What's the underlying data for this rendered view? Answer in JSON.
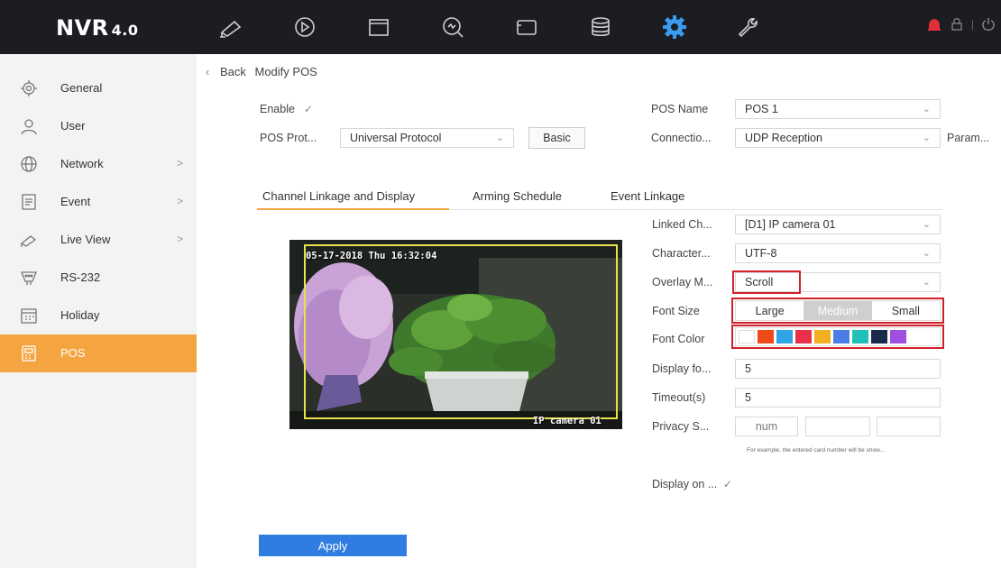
{
  "header": {
    "logo_main": "NVR",
    "logo_version": "4.0",
    "nav_icons": [
      "live-view-icon",
      "playback-icon",
      "file-icon",
      "smart-search-icon",
      "picture-icon",
      "storage-icon",
      "settings-icon",
      "maintenance-icon"
    ],
    "active_nav": "settings-icon",
    "accent": "#3b9bf0",
    "alarm_color": "#e0303a"
  },
  "sidebar": {
    "items": [
      {
        "label": "General",
        "icon": "gear-icon",
        "has_chevron": false
      },
      {
        "label": "User",
        "icon": "user-icon",
        "has_chevron": false
      },
      {
        "label": "Network",
        "icon": "globe-icon",
        "has_chevron": true
      },
      {
        "label": "Event",
        "icon": "event-icon",
        "has_chevron": true
      },
      {
        "label": "Live View",
        "icon": "camera-icon",
        "has_chevron": true
      },
      {
        "label": "RS-232",
        "icon": "rs232-icon",
        "has_chevron": false
      },
      {
        "label": "Holiday",
        "icon": "calendar-icon",
        "has_chevron": false
      },
      {
        "label": "POS",
        "icon": "pos-icon",
        "has_chevron": false
      }
    ],
    "active_label": "POS",
    "chevron": ">"
  },
  "breadcrumb": {
    "back": "Back",
    "title": "Modify POS"
  },
  "form": {
    "enable_label": "Enable",
    "pos_protocol_label": "POS Prot...",
    "pos_protocol_value": "Universal Protocol",
    "basic_button": "Basic",
    "pos_name_label": "POS Name",
    "pos_name_value": "POS 1",
    "connection_label": "Connectio...",
    "connection_value": "UDP Reception",
    "param_button": "Param..."
  },
  "tabs": [
    {
      "label": "Channel Linkage and Display",
      "active": true
    },
    {
      "label": "Arming Schedule",
      "active": false
    },
    {
      "label": "Event Linkage",
      "active": false
    }
  ],
  "preview": {
    "osd_datetime": "05-17-2018 Thu 16:32:04",
    "osd_camera": "IP camera 01"
  },
  "display": {
    "linked_channel_label": "Linked Ch...",
    "linked_channel_value": "[D1] IP camera 01",
    "character_label": "Character...",
    "character_value": "UTF-8",
    "overlay_label": "Overlay M...",
    "overlay_value": "Scroll",
    "font_size_label": "Font Size",
    "font_sizes": [
      "Large",
      "Medium",
      "Small"
    ],
    "font_size_selected": "Medium",
    "font_color_label": "Font Color",
    "font_colors": [
      "#ffffff",
      "#f04a1a",
      "#2fa3e6",
      "#e8304a",
      "#f0b020",
      "#4a7de8",
      "#1fc0b8",
      "#1a2a4a",
      "#a050e0"
    ],
    "display_for_label": "Display fo...",
    "display_for_value": "5",
    "timeout_label": "Timeout(s)",
    "timeout_value": "5",
    "privacy_label": "Privacy S...",
    "privacy_value": "num",
    "hint": "For example, the entered card number will be show...",
    "display_on_label": "Display on ..."
  },
  "apply_button": "Apply"
}
